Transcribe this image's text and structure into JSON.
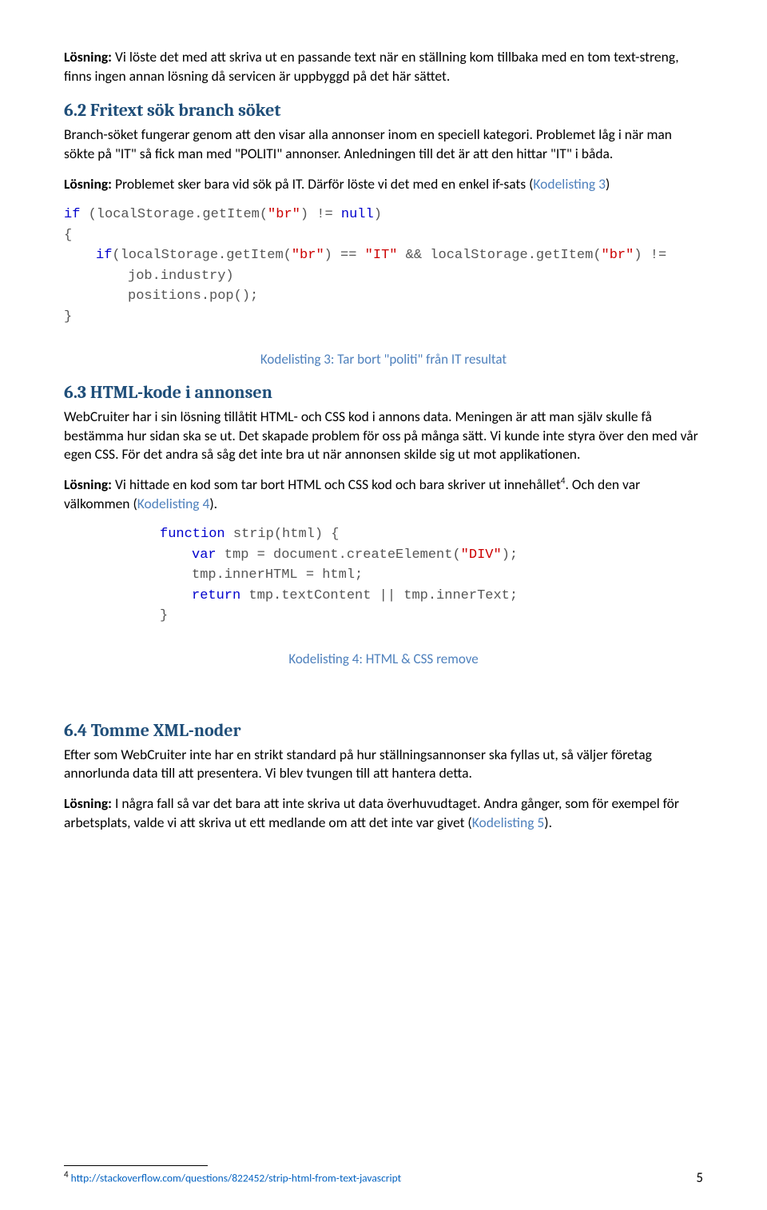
{
  "p1": {
    "lead": "Lösning:",
    "body": " Vi löste det med att skriva ut en passande text när en ställning kom tillbaka med en tom text-streng, finns ingen annan lösning då servicen är uppbyggd på det här sättet."
  },
  "s62": {
    "num": "6.2",
    "title": "Fritext sök branch söket",
    "p1": "Branch-söket fungerar genom att den visar alla annonser inom en speciell kategori. Problemet låg i när man sökte på \"IT\" så fick man med \"POLITI\" annonser. Anledningen till det är att den hittar \"IT\" i båda.",
    "p2_lead": "Lösning:",
    "p2_body": " Problemet sker bara vid sök på IT. Därför löste vi det med en enkel if-sats (",
    "p2_ref": "Kodelisting 3",
    "p2_tail": ")"
  },
  "code1": {
    "l1a": "if",
    "l1b": " (localStorage.getItem(",
    "l1c": "\"br\"",
    "l1d": ") != ",
    "l1e": "null",
    "l1f": ")",
    "l2": "{",
    "l3a": "if",
    "l3b": "(localStorage.getItem(",
    "l3c": "\"br\"",
    "l3d": ") == ",
    "l3e": "\"IT\"",
    "l3f": " && localStorage.getItem(",
    "l3g": "\"br\"",
    "l3h": ") !=",
    "l4": "job.industry)",
    "l5": "positions.pop();",
    "l6": "}"
  },
  "caption3": "Kodelisting 3: Tar bort \"politi\" från IT resultat",
  "s63": {
    "num": "6.3",
    "title": "HTML-kode i annonsen",
    "p1": "WebCruiter har i sin lösning tillåtit HTML- och CSS kod i annons data. Meningen är att man själv skulle få bestämma hur sidan ska se ut. Det skapade problem för oss på många sätt. Vi kunde inte styra över den med vår egen CSS. För det andra så såg det inte bra ut när annonsen skilde sig ut mot applikationen.",
    "p2_lead": "Lösning:",
    "p2_body_a": " Vi hittade en kod som tar bort HTML och CSS kod och bara skriver ut innehållet",
    "p2_sup": "4",
    "p2_body_b": ". Och den var välkommen (",
    "p2_ref": "Kodelisting 4",
    "p2_tail": ")."
  },
  "code2": {
    "l1a": "function",
    "l1b": " strip(html) {",
    "l2a": "var",
    "l2b": " tmp = document.createElement(",
    "l2c": "\"DIV\"",
    "l2d": ");",
    "l3": "tmp.innerHTML = html;",
    "l4a": "return",
    "l4b": " tmp.textContent || tmp.innerText;",
    "l5": "}"
  },
  "caption4": "Kodelisting 4: HTML & CSS remove",
  "s64": {
    "num": "6.4",
    "title": "Tomme XML-noder",
    "p1": "Efter som WebCruiter inte har en strikt standard på hur ställningsannonser ska fyllas ut, så väljer företag annorlunda data till att presentera. Vi blev tvungen till att hantera detta.",
    "p2_lead": "Lösning:",
    "p2_body": " I några fall så var det bara att inte skriva ut data överhuvudtaget. Andra gånger, som för exempel för arbetsplats, valde vi att skriva ut ett medlande om att det inte var givet (",
    "p2_ref": "Kodelisting 5",
    "p2_tail": ")."
  },
  "footnote": {
    "num": "4",
    "url": "http://stackoverflow.com/questions/822452/strip-html-from-text-javascript"
  },
  "pagenum": "5"
}
